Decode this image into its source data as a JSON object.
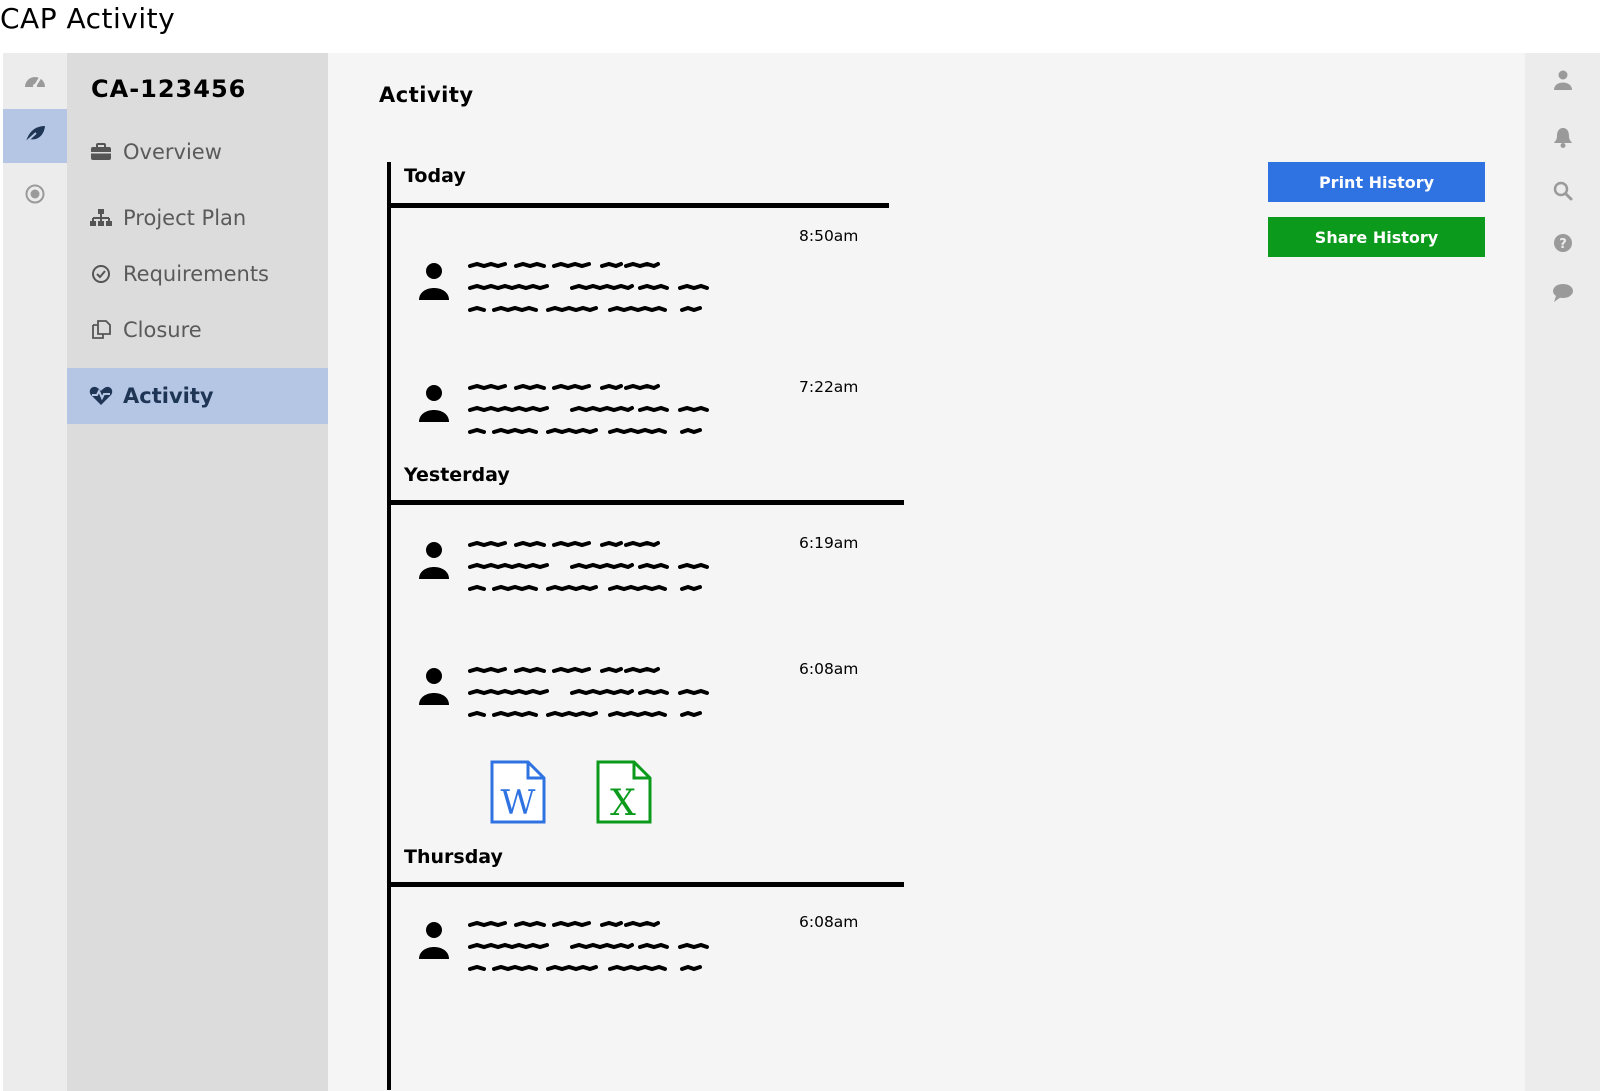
{
  "app_title": "CAP Activity",
  "icon_rail": {
    "items": [
      {
        "icon": "dashboard-icon",
        "active": false
      },
      {
        "icon": "leaf-icon",
        "active": true
      },
      {
        "icon": "target-icon",
        "active": false
      }
    ]
  },
  "nav": {
    "case_id": "CA-123456",
    "items": [
      {
        "label": "Overview",
        "icon": "briefcase-icon",
        "active": false
      },
      {
        "label": "Project Plan",
        "icon": "sitemap-icon",
        "active": false
      },
      {
        "label": "Requirements",
        "icon": "check-circle-icon",
        "active": false
      },
      {
        "label": "Closure",
        "icon": "copy-icon",
        "active": false
      },
      {
        "label": "Activity",
        "icon": "heartbeat-icon",
        "active": true
      }
    ]
  },
  "main": {
    "title": "Activity",
    "groups": [
      {
        "label": "Today",
        "entries": [
          {
            "time": "8:50am"
          },
          {
            "time": "7:22am"
          }
        ]
      },
      {
        "label": "Yesterday",
        "entries": [
          {
            "time": "6:19am"
          },
          {
            "time": "6:08am",
            "attachments": [
              "word-file-icon",
              "excel-file-icon"
            ]
          }
        ]
      },
      {
        "label": "Thursday",
        "entries": [
          {
            "time": "6:08am"
          }
        ]
      }
    ],
    "actions": {
      "print_label": "Print History",
      "share_label": "Share History"
    }
  },
  "right_rail": {
    "icons": [
      "user-icon",
      "bell-icon",
      "search-icon",
      "help-icon",
      "chat-icon"
    ]
  },
  "colors": {
    "accent_blue": "#2f73e3",
    "accent_green": "#0b9a1b",
    "active_nav": "#b4c6e3"
  }
}
